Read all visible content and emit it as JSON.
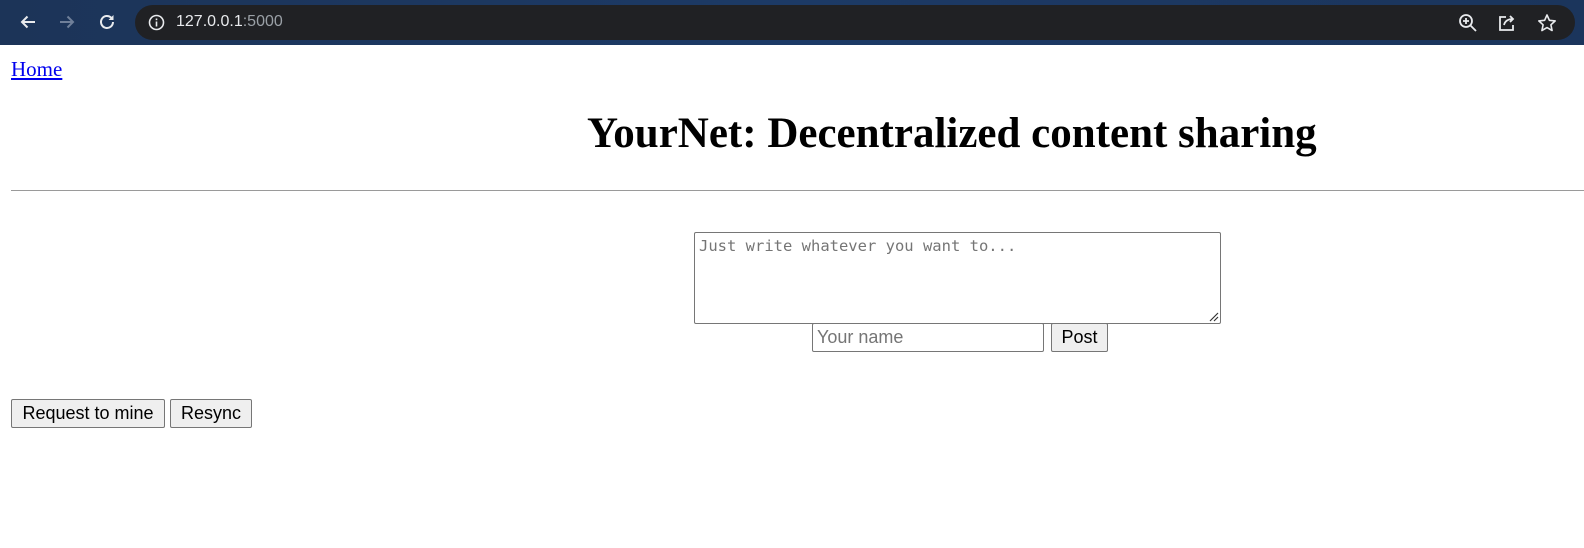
{
  "browser": {
    "url_host": "127.0.0.1",
    "url_port": ":5000",
    "icons": {
      "back": "arrow-left-icon",
      "forward": "arrow-right-icon",
      "reload": "reload-icon",
      "site_info": "info-icon",
      "zoom": "zoom-in-icon",
      "share": "share-icon",
      "bookmark": "star-icon"
    }
  },
  "nav": {
    "home_label": "Home"
  },
  "header": {
    "title": "YourNet: Decentralized content sharing"
  },
  "post_form": {
    "content_placeholder": "Just write whatever you want to...",
    "name_placeholder": "Your name",
    "post_label": "Post"
  },
  "actions": {
    "mine_label": "Request to mine",
    "resync_label": "Resync"
  },
  "colors": {
    "chrome_bg": "#1c3458",
    "omnibox_bg": "#202124",
    "link": "#0000ee"
  }
}
